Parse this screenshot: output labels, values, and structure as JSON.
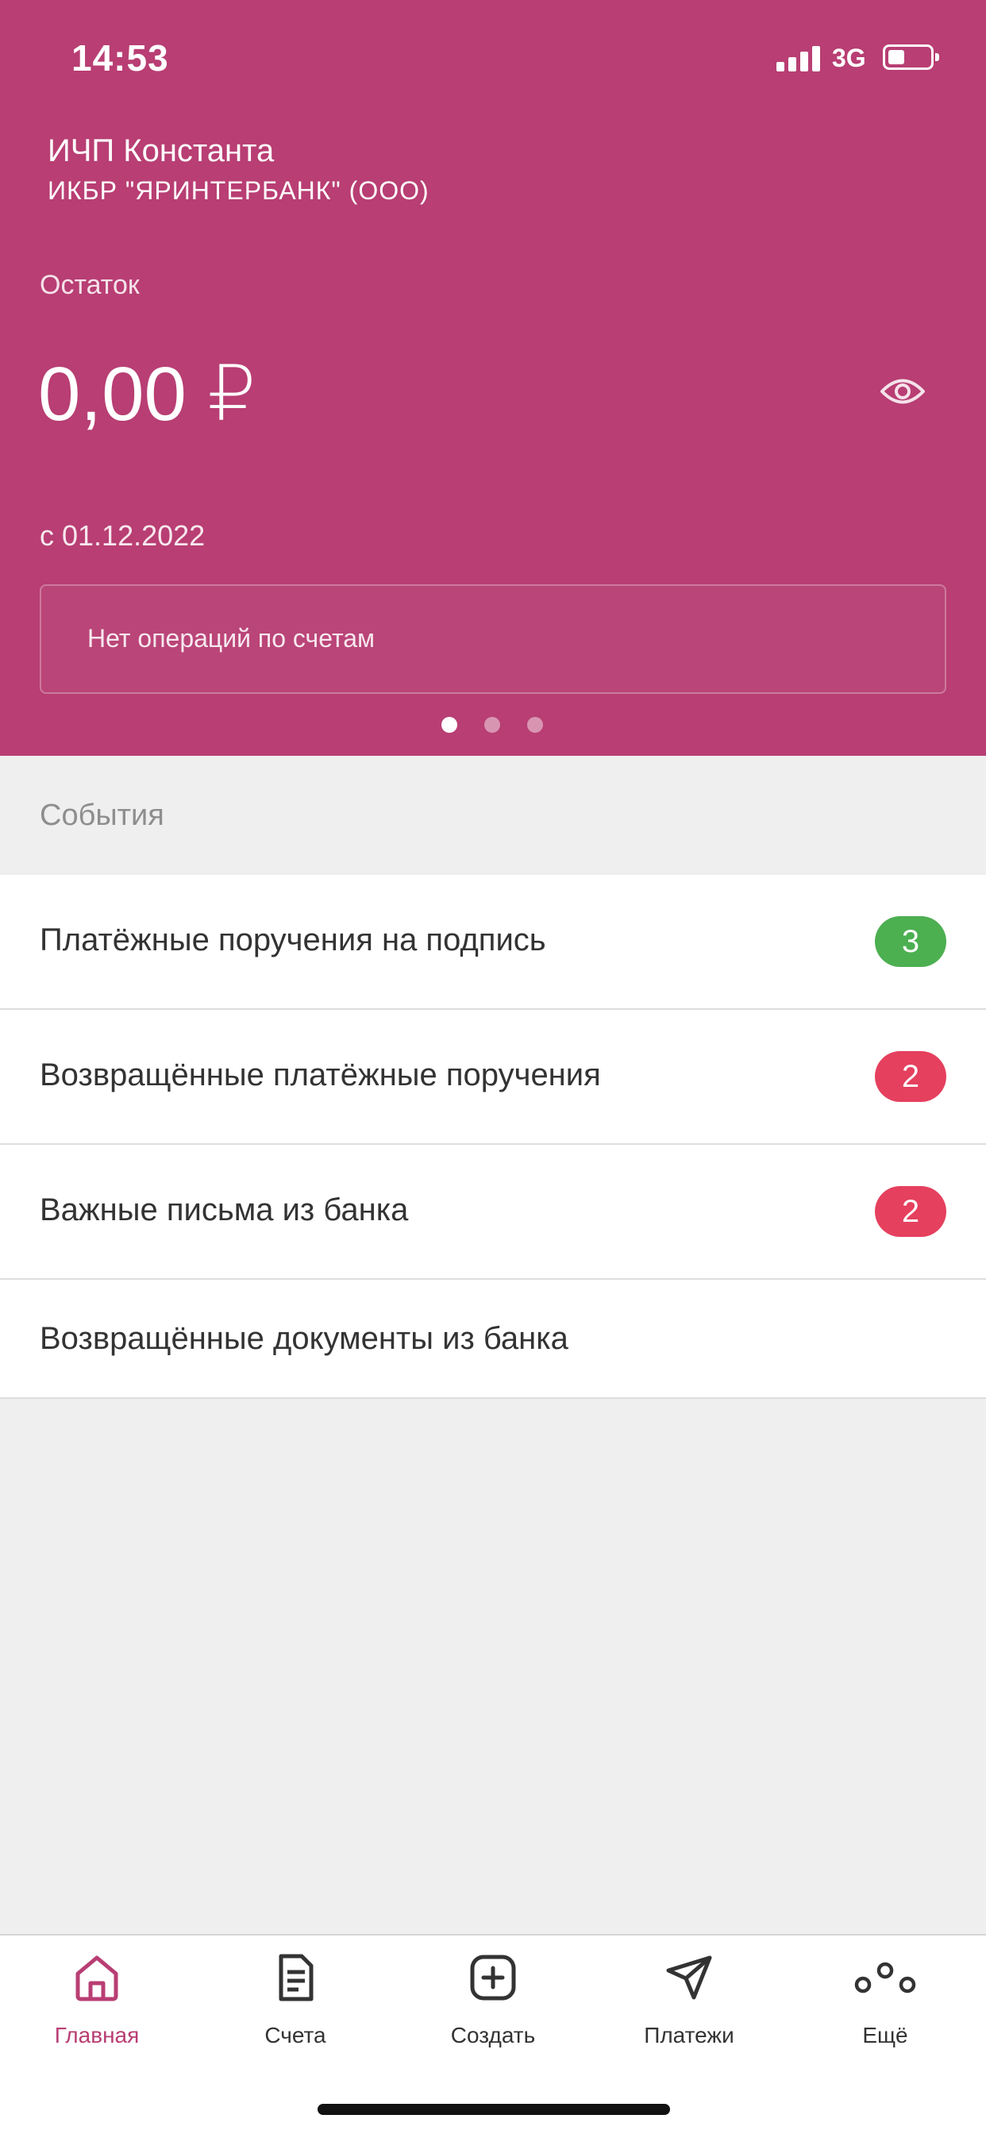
{
  "status_bar": {
    "time": "14:53",
    "network": "3G"
  },
  "header": {
    "org_name": "ИЧП Константа",
    "bank_name": "ИКБР \"ЯРИНТЕРБАНК\" (ООО)",
    "balance_label": "Остаток",
    "balance_value": "0,00 ₽",
    "date_text": "с 01.12.2022",
    "operations_text": "Нет операций по счетам",
    "pager": {
      "count": 3,
      "active_index": 0
    }
  },
  "events": {
    "title": "События",
    "items": [
      {
        "label": "Платёжные поручения на подпись",
        "badge": "3",
        "badge_color": "#4caf50"
      },
      {
        "label": "Возвращённые платёжные поручения",
        "badge": "2",
        "badge_color": "#e5405e"
      },
      {
        "label": "Важные письма из банка",
        "badge": "2",
        "badge_color": "#e5405e"
      },
      {
        "label": "Возвращённые документы из банка"
      }
    ]
  },
  "bottom_nav": {
    "items": [
      {
        "label": "Главная",
        "icon": "home-icon",
        "active": true
      },
      {
        "label": "Счета",
        "icon": "document-icon"
      },
      {
        "label": "Создать",
        "icon": "plus-square-icon"
      },
      {
        "label": "Платежи",
        "icon": "paper-plane-icon"
      },
      {
        "label": "Ещё",
        "icon": "more-dots-icon"
      }
    ]
  },
  "colors": {
    "brand": "#b83e73",
    "badge_green": "#4caf50",
    "badge_red": "#e5405e"
  }
}
